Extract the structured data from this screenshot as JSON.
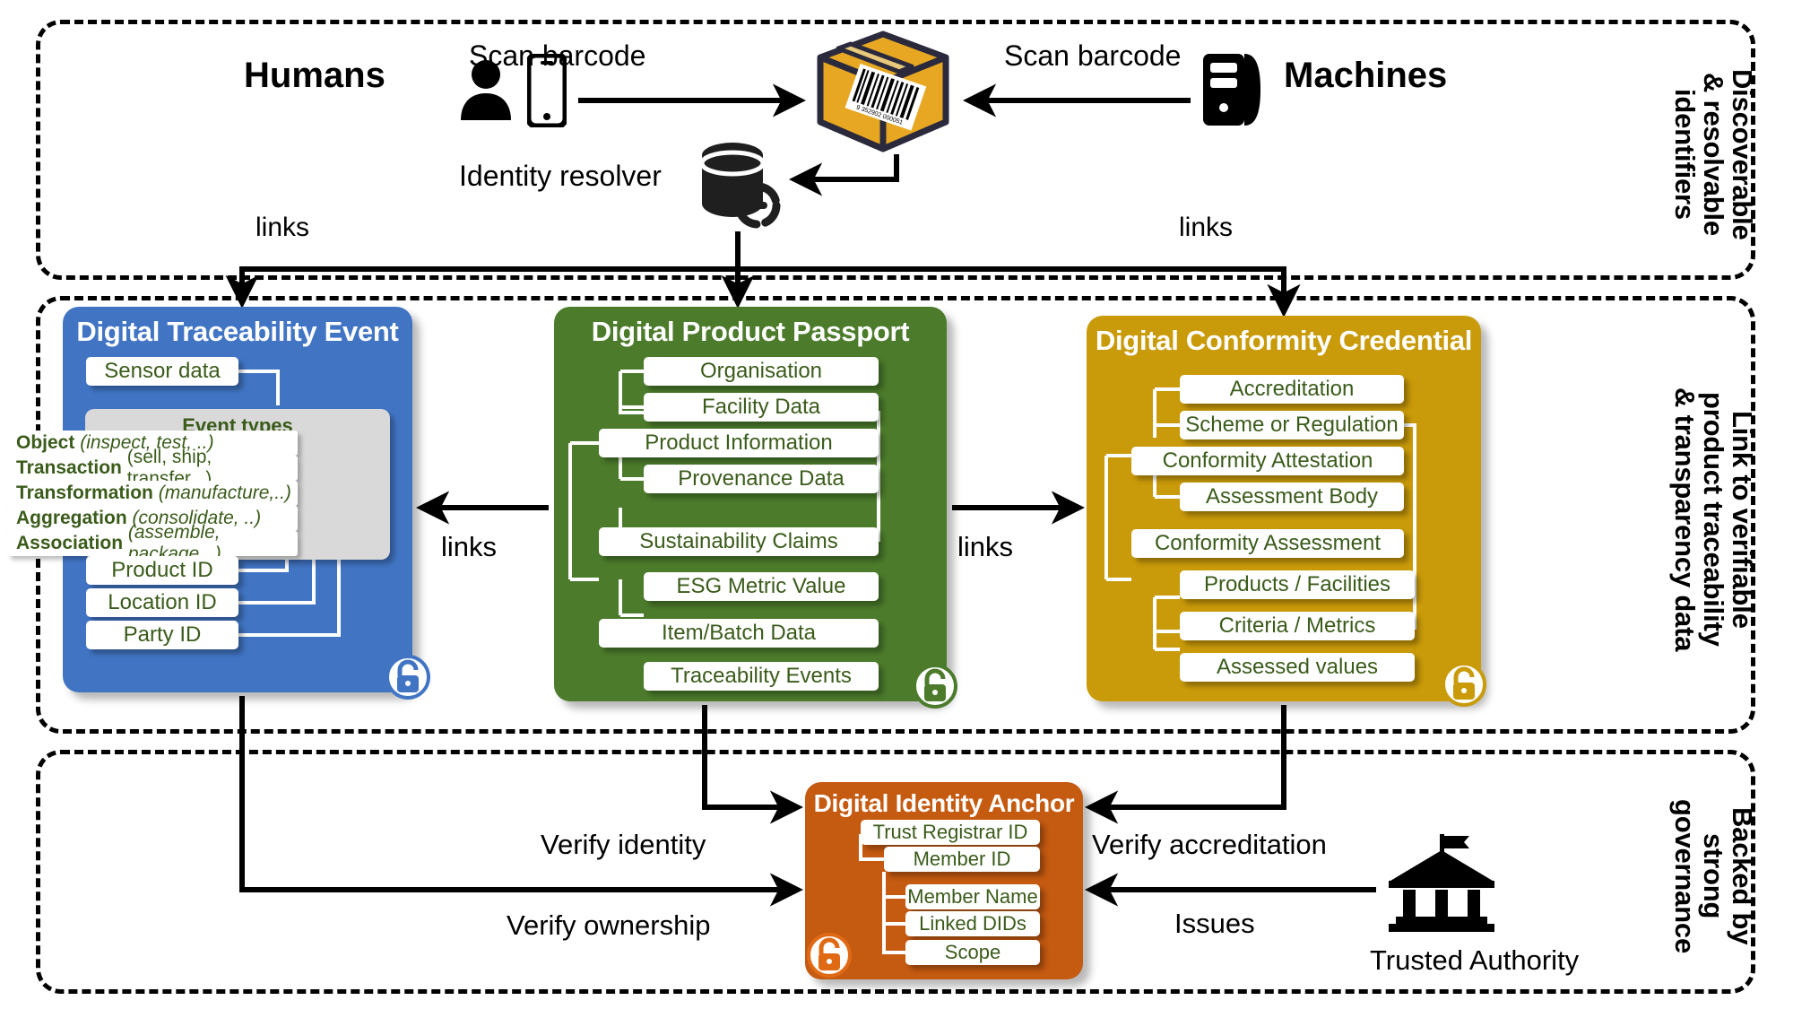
{
  "sections": [
    {
      "id": "top",
      "label": "Discoverable\n& resolvable\nidentifiers"
    },
    {
      "id": "mid",
      "label": "Link to verifiable\nproduct traceability\n& transparency data"
    },
    {
      "id": "bot",
      "label": "Backed by\nstrong\ngovernance"
    }
  ],
  "top": {
    "humans_label": "Humans",
    "machines_label": "Machines",
    "scan_left_label": "Scan barcode",
    "scan_right_label": "Scan barcode",
    "resolver_label": "Identity resolver",
    "links_left_label": "links",
    "links_right_label": "links",
    "icons": {
      "human": "person-icon",
      "phone": "smartphone-icon",
      "package": "package-barcode-icon",
      "server": "server-tower-icon",
      "database": "database-link-icon"
    }
  },
  "middle": {
    "links_left_label": "links",
    "links_right_label": "links",
    "traceability": {
      "title": "Digital Traceability Event",
      "accent": "#4175C4",
      "sensor_item": "Sensor data",
      "event_panel_title": "Event types",
      "event_types": [
        {
          "name": "Object",
          "detail": "(inspect, test, ..)",
          "detail_italic": true
        },
        {
          "name": "Transaction",
          "detail": "(sell, ship, transfer,..)",
          "detail_italic": false
        },
        {
          "name": "Transformation",
          "detail": "(manufacture,..)",
          "detail_italic": true
        },
        {
          "name": "Aggregation",
          "detail": "(consolidate, ..)",
          "detail_italic": true
        },
        {
          "name": "Association",
          "detail": "(assemble, package,..)",
          "detail_italic": true
        }
      ],
      "id_items": [
        "Product ID",
        "Location ID",
        "Party ID"
      ],
      "lock_icon": "lock-icon"
    },
    "passport": {
      "title": "Digital Product Passport",
      "accent": "#4B7B2B",
      "items": [
        "Organisation",
        "Facility Data",
        "Product Information",
        "Provenance Data",
        "Sustainability Claims",
        "ESG Metric Value",
        "Item/Batch Data",
        "Traceability Events"
      ],
      "lock_icon": "lock-icon"
    },
    "conformity": {
      "title": "Digital Conformity Credential",
      "accent": "#C99A09",
      "items": [
        "Accreditation",
        "Scheme or Regulation",
        "Conformity Attestation",
        "Assessment Body",
        "Conformity Assessment",
        "Products / Facilities",
        "Criteria / Metrics",
        "Assessed values"
      ],
      "lock_icon": "lock-icon"
    }
  },
  "bottom": {
    "anchor": {
      "title": "Digital Identity Anchor",
      "accent": "#C55A11",
      "items": [
        "Trust Registrar ID",
        "Member ID",
        "Member Name",
        "Linked DIDs",
        "Scope"
      ],
      "lock_icon": "lock-icon"
    },
    "verify_identity_label": "Verify identity",
    "verify_ownership_label": "Verify ownership",
    "verify_accreditation_label": "Verify accreditation",
    "issues_label": "Issues",
    "trusted_authority_label": "Trusted Authority",
    "trusted_authority_icon": "bank-institution-icon"
  }
}
